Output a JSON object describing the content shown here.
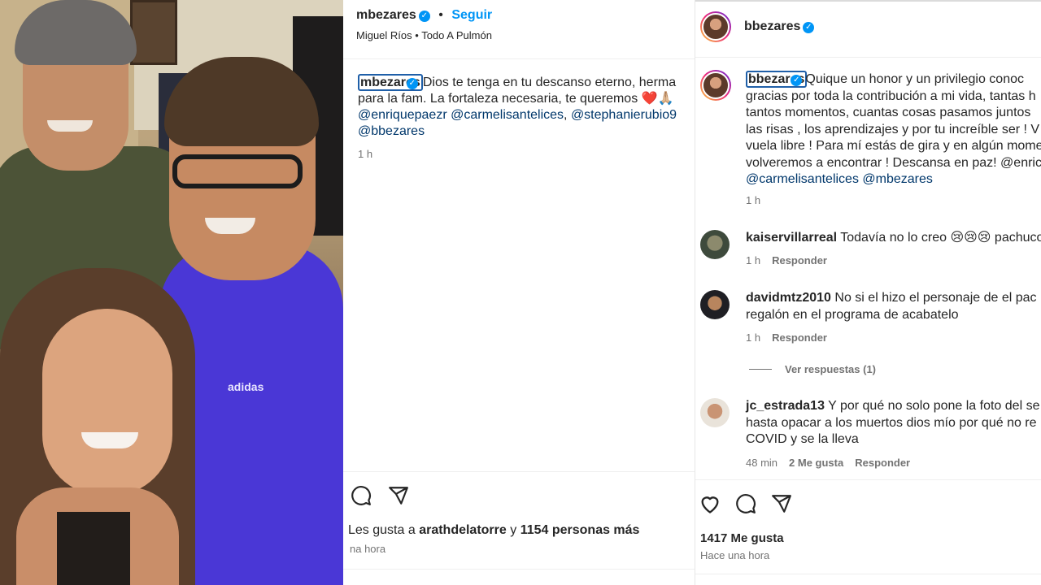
{
  "left_post": {
    "username": "mbezares",
    "follow_label": "Seguir",
    "music_artist": "Miguel Ríos",
    "music_song": "Todo A Pulmón",
    "caption_mention": "mbezares",
    "caption_line1": "Dios te tenga en tu descanso eterno, herma",
    "caption_line2": "para la fam. La fortaleza necesaria, te queremos ❤️🙏🏼",
    "tag1": "@enriquepaezr",
    "tag2": "@carmelisantelices",
    "tag3": "@stephanierubio9",
    "tag4": "@bbezares",
    "caption_time": "1 h",
    "likes_prefix": "Les gusta a",
    "likes_user": "arathdelatorre",
    "likes_conj": "y",
    "likes_count": "1154 personas más",
    "post_time": "na hora"
  },
  "right_post": {
    "username": "bbezares",
    "caption_mention": "bbezares",
    "caption_lines": [
      "Quique un honor y un privilegio conoc",
      "gracias por toda la contribución a mi vida, tantas h",
      "tantos momentos, cuantas cosas pasamos juntos",
      "las risas , los aprendizajes y por tu increíble ser ! V",
      "vuela libre ! Para mí estás de gira y en algún mome",
      "volveremos a encontrar ! Descansa en paz! @enric"
    ],
    "caption_tag1": "@carmelisantelices",
    "caption_tag2": "@mbezares",
    "caption_time": "1 h",
    "comments": [
      {
        "user": "kaiservillarreal",
        "text": "Todavía no lo creo 😢😢😢 pachuco",
        "time": "1 h",
        "reply": "Responder"
      },
      {
        "user": "davidmtz2010",
        "text": "No si el hizo el personaje de el pac",
        "text2": "regalón en el programa de acabatelo",
        "time": "1 h",
        "reply": "Responder"
      },
      {
        "user": "jc_estrada13",
        "text": "Y por qué no solo pone la foto del se",
        "text2": "hasta opacar a los muertos dios mío por qué no re",
        "text3": "COVID y se la lleva",
        "time": "48 min",
        "likes": "2 Me gusta",
        "reply": "Responder"
      }
    ],
    "view_replies": "Ver respuestas (1)",
    "likes_count": "1417 Me gusta",
    "post_time": "Hace una hora"
  },
  "colors": {
    "link_blue": "#0095f6",
    "mention_blue": "#00376b",
    "meta_gray": "#737373"
  },
  "icons": [
    "comment-icon",
    "share-icon",
    "heart-icon",
    "verified-icon"
  ]
}
